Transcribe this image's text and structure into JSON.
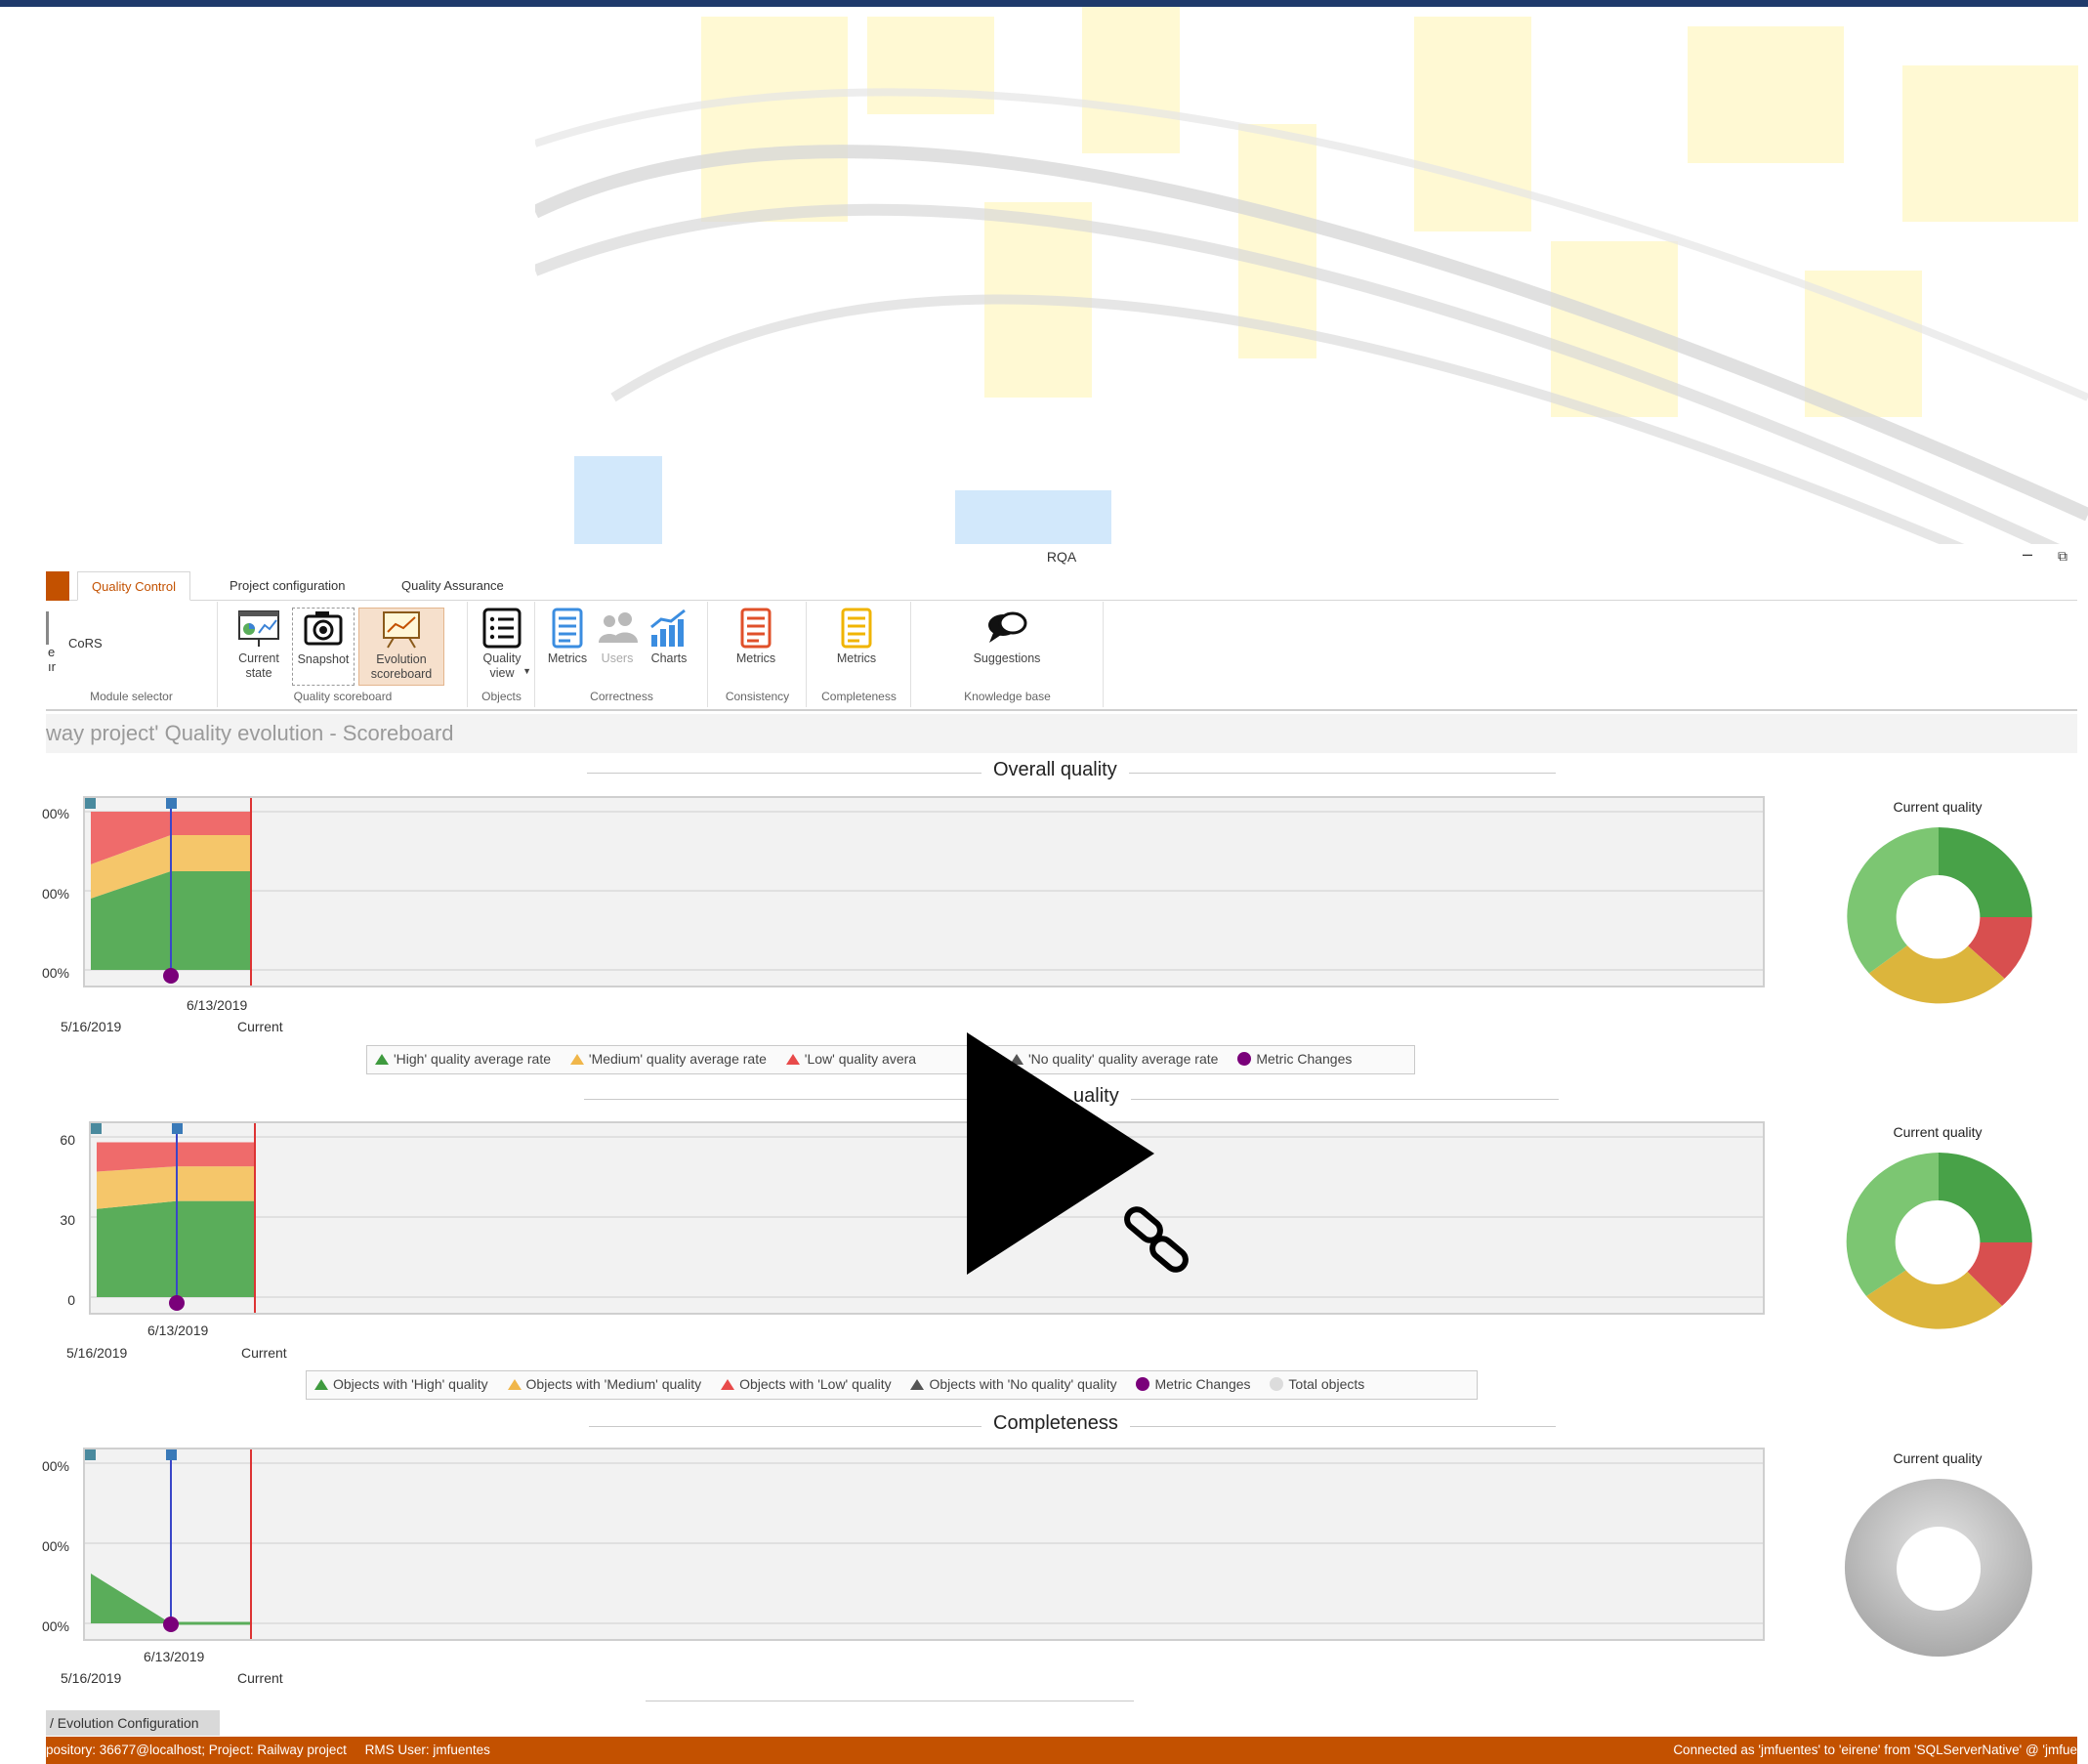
{
  "window": {
    "title": "RQA",
    "minimize_glyph": "–",
    "restore_glyph": "⧉"
  },
  "tabs": [
    {
      "label": "Quality Control"
    },
    {
      "label": "Project configuration"
    },
    {
      "label": "Quality Assurance"
    }
  ],
  "ribbon": {
    "module_selector": {
      "item": "CoRS",
      "label": "Module selector",
      "cut_lines": [
        "e",
        "ır"
      ]
    },
    "quality_scoreboard": {
      "label": "Quality scoreboard",
      "current_state": "Current state",
      "snapshot": "Snapshot",
      "evolution": "Evolution scoreboard"
    },
    "objects": {
      "label": "Objects",
      "quality_view": "Quality view"
    },
    "correctness": {
      "label": "Correctness",
      "metrics": "Metrics",
      "users": "Users",
      "charts": "Charts"
    },
    "consistency": {
      "label": "Consistency",
      "metrics": "Metrics"
    },
    "completeness": {
      "label": "Completeness",
      "metrics": "Metrics"
    },
    "knowledge_base": {
      "label": "Knowledge base",
      "suggestions": "Suggestions"
    }
  },
  "breadcrumb": "way project' Quality evolution - Scoreboard",
  "sections": {
    "overall": {
      "title": "Overall quality",
      "yticks": [
        "00%",
        "00%",
        "00%"
      ]
    },
    "objects": {
      "title": "uality",
      "yticks": [
        "60",
        "30",
        "0"
      ]
    },
    "completeness": {
      "title": "Completeness",
      "yticks": [
        "00%",
        "00%",
        "00%"
      ]
    }
  },
  "xlabels": {
    "start": "5/16/2019",
    "mid": "6/13/2019",
    "end": "Current"
  },
  "pie_title": "Current quality",
  "legend1": [
    "'High' quality average rate",
    "'Medium' quality average rate",
    "'Low' quality avera",
    "'No quality' quality average rate",
    "Metric Changes"
  ],
  "legend2": [
    "Objects with 'High' quality",
    "Objects with 'Medium' quality",
    "Objects with 'Low' quality",
    "Objects with 'No quality' quality",
    "Metric Changes",
    "Total objects"
  ],
  "bottom_tab": "/ Evolution Configuration",
  "status": {
    "left": "pository: 36677@localhost; Project: Railway project     RMS User: jmfuentes",
    "right": "Connected as 'jmfuentes' to 'eirene' from 'SQLServerNative' @ 'jmfue"
  },
  "colors": {
    "high": "#5aad5a",
    "medium": "#f5c66a",
    "low": "#ef6b6b",
    "none": "#666666",
    "metric_change": "#7a007a",
    "total": "#d6d6d6",
    "accent": "#c35100",
    "header": "#1f3a6b"
  },
  "chart_data": [
    {
      "type": "area",
      "title": "Overall quality",
      "x": [
        "5/16/2019",
        "6/13/2019",
        "Current"
      ],
      "series": [
        {
          "name": "'High' quality average rate",
          "color": "#5aad5a"
        },
        {
          "name": "'Medium' quality average rate",
          "color": "#f5c66a"
        },
        {
          "name": "'Low' quality avera",
          "color": "#ef6b6b"
        },
        {
          "name": "'No quality' quality average rate",
          "color": "#666666"
        },
        {
          "name": "Metric Changes",
          "color": "#7a007a"
        }
      ]
    },
    {
      "type": "area",
      "x": [
        "5/16/2019",
        "6/13/2019",
        "Current"
      ],
      "ylim": [
        0,
        60
      ],
      "series": [
        {
          "name": "Objects with 'High' quality",
          "values": [
            33,
            36,
            36
          ]
        },
        {
          "name": "Objects with 'Medium' quality",
          "values": [
            14,
            13,
            13
          ]
        },
        {
          "name": "Objects with 'Low' quality",
          "values": [
            11,
            9,
            9
          ]
        },
        {
          "name": "Objects with 'No quality' quality",
          "values": [
            0,
            0,
            0
          ]
        }
      ]
    },
    {
      "type": "area",
      "title": "Completeness",
      "x": [
        "5/16/2019",
        "6/13/2019",
        "Current"
      ]
    },
    {
      "type": "pie",
      "title": "Current quality",
      "slices": [
        {
          "color": "#5aad5a",
          "value": 0.61
        },
        {
          "color": "#ef6b6b",
          "value": 0.14
        },
        {
          "color": "#f5c66a",
          "value": 0.25
        }
      ]
    },
    {
      "type": "pie",
      "title": "Current quality",
      "slices": [
        {
          "color": "#5aad5a",
          "value": 0.61
        },
        {
          "color": "#ef6b6b",
          "value": 0.15
        },
        {
          "color": "#f5c66a",
          "value": 0.24
        }
      ]
    },
    {
      "type": "pie",
      "title": "Current quality",
      "slices": [
        {
          "color": "#bdbdbd",
          "value": 1.0
        }
      ]
    }
  ]
}
